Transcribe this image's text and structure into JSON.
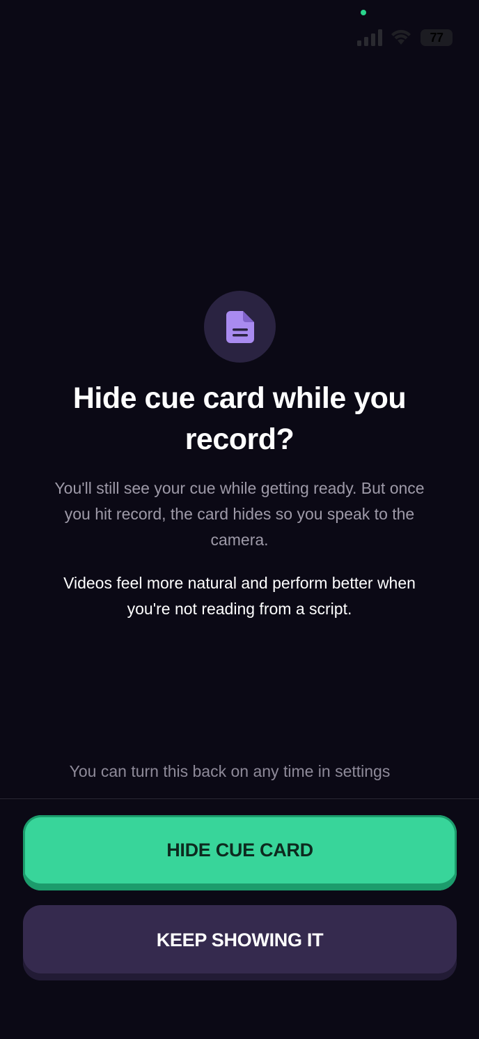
{
  "status_bar": {
    "battery_level": "77",
    "colors": {
      "camera_indicator": "#2ad58c",
      "battery_fill": "#ffffff"
    }
  },
  "dialog": {
    "icon": "document-icon",
    "title": "Hide cue card while you record?",
    "description": "You'll still see your cue while getting ready. But once you hit record, the card hides so you speak to the camera.",
    "emphasis": "Videos feel more natural and perform better when you're not reading from a script.",
    "settings_note": "You can turn this back on any time in settings"
  },
  "actions": {
    "primary_label": "HIDE CUE CARD",
    "secondary_label": "KEEP SHOWING IT"
  },
  "colors": {
    "background": "#0b0915",
    "primary": "#38d59a",
    "secondary": "#352a4e",
    "icon_accent": "#a98bf0"
  }
}
